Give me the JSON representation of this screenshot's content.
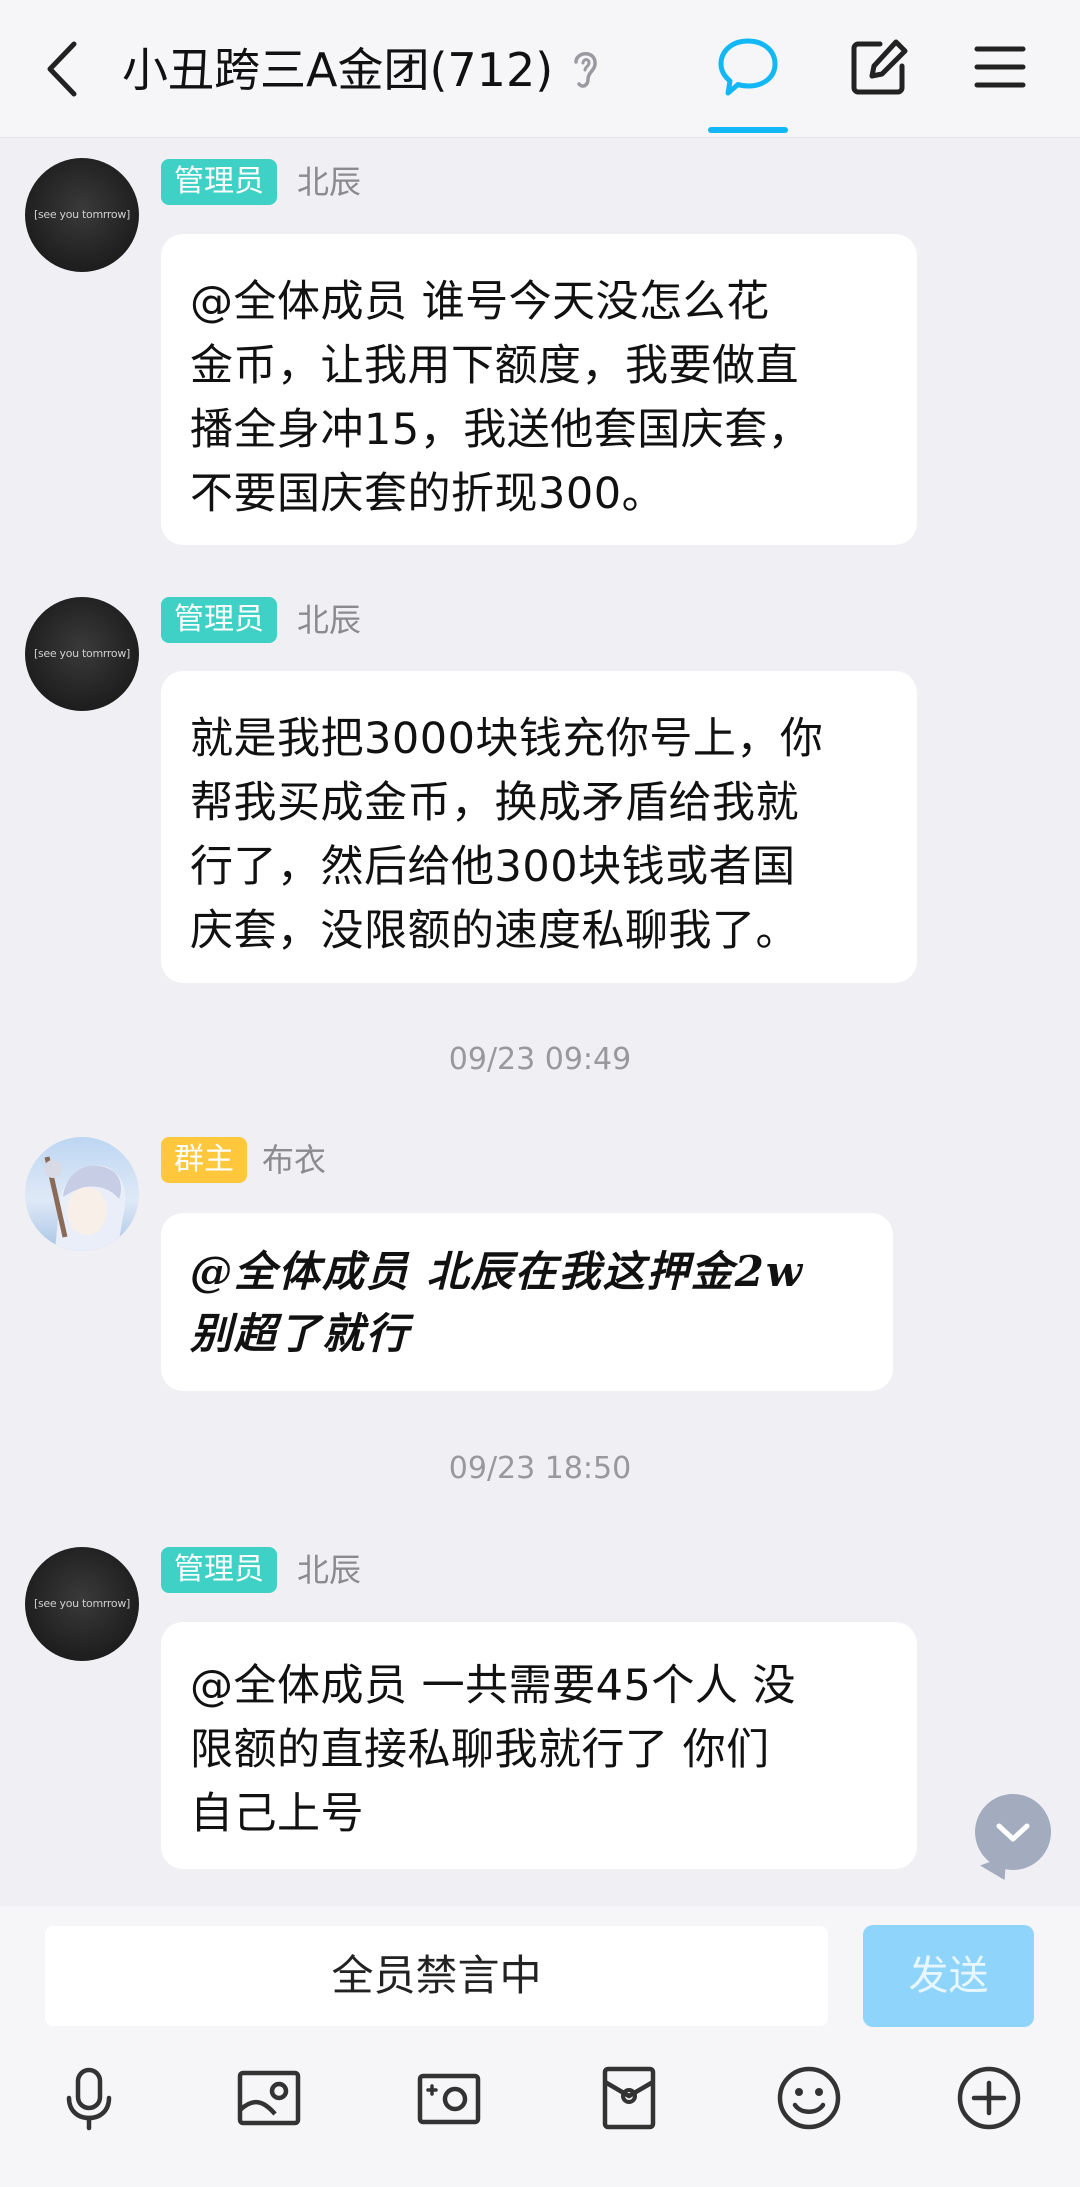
{
  "header": {
    "title": "小丑跨三A金团(712)",
    "icons": [
      "back-icon",
      "ear-icon",
      "chat-bubble-icon",
      "edit-icon",
      "menu-icon"
    ],
    "accent_color": "#12b7f5"
  },
  "messages": [
    {
      "role": "管理员",
      "sender": "北辰",
      "avatar_text": "[see you tomrrow]",
      "lines": [
        "@全体成员  谁号今天没怎么花",
        "金币，让我用下额度，我要做直",
        "播全身冲15，我送他套国庆套，",
        "不要国庆套的折现300。"
      ]
    },
    {
      "role": "管理员",
      "sender": "北辰",
      "avatar_text": "[see you tomrrow]",
      "lines": [
        "就是我把3000块钱充你号上，你",
        "帮我买成金币，换成矛盾给我就",
        "行了，然后给他300块钱或者国",
        "庆套，没限额的速度私聊我了。"
      ]
    },
    {
      "role": "群主",
      "sender": "布衣",
      "lines": [
        "@全体成员  北辰在我这押金2w",
        "别超了就行"
      ]
    },
    {
      "role": "管理员",
      "sender": "北辰",
      "avatar_text": "[see you tomrrow]",
      "lines": [
        "@全体成员 一共需要45个人 没",
        "限额的直接私聊我就行了  你们",
        "自己上号"
      ]
    }
  ],
  "timestamps": [
    "09/23 09:49",
    "09/23 18:50"
  ],
  "input": {
    "text": "全员禁言中",
    "send_label": "发送"
  },
  "toolbar": [
    "microphone-icon",
    "image-icon",
    "camera-icon",
    "red-packet-icon",
    "emoji-icon",
    "plus-icon"
  ]
}
